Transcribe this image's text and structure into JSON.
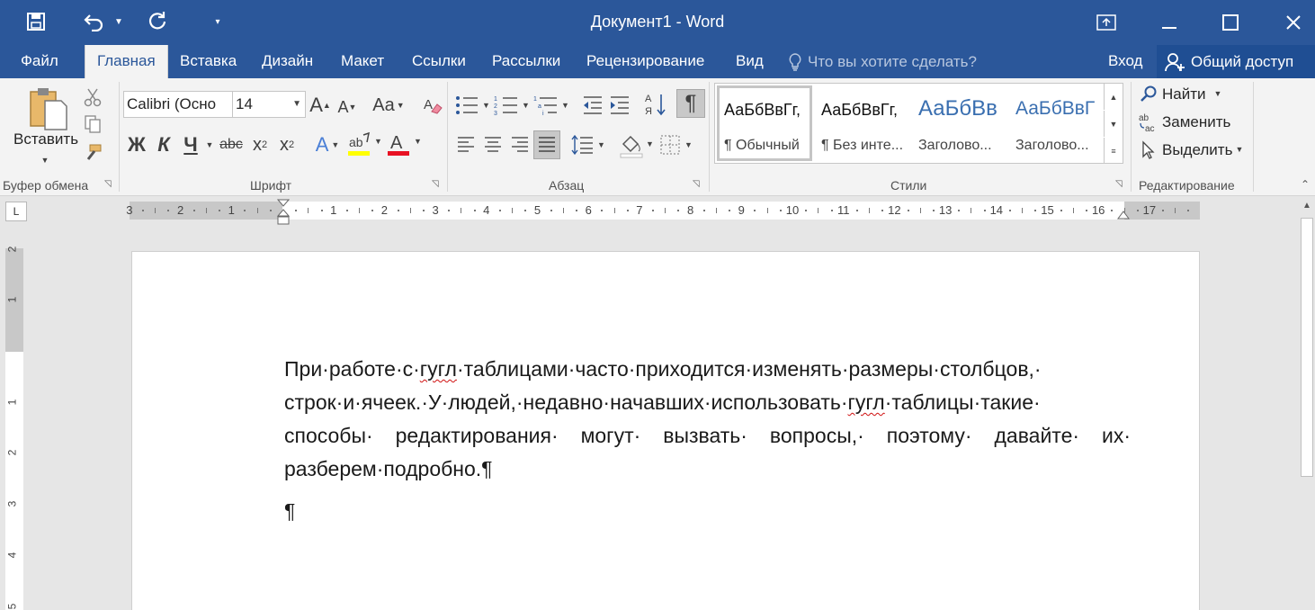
{
  "window": {
    "title": "Документ1 - Word"
  },
  "tabs": [
    {
      "label": "Файл"
    },
    {
      "label": "Главная"
    },
    {
      "label": "Вставка"
    },
    {
      "label": "Дизайн"
    },
    {
      "label": "Макет"
    },
    {
      "label": "Ссылки"
    },
    {
      "label": "Рассылки"
    },
    {
      "label": "Рецензирование"
    },
    {
      "label": "Вид"
    }
  ],
  "tellme_placeholder": "Что вы хотите сделать?",
  "signin_label": "Вход",
  "share_label": "Общий доступ",
  "clipboard": {
    "paste_label": "Вставить",
    "group_label": "Буфер обмена"
  },
  "font": {
    "name": "Calibri (Осно",
    "size": "14",
    "group_label": "Шрифт",
    "bold": "Ж",
    "italic": "К",
    "underline": "Ч",
    "strike": "abc",
    "change_case": "Aa",
    "grow": "A",
    "shrink": "A",
    "font_color": "A",
    "text_effects": "A"
  },
  "paragraph": {
    "group_label": "Абзац",
    "pilcrow": "¶"
  },
  "styles": {
    "group_label": "Стили",
    "items": [
      {
        "sample": "АаБбВвГг,",
        "name": "¶ Обычный"
      },
      {
        "sample": "АаБбВвГг,",
        "name": "¶ Без инте..."
      },
      {
        "sample": "АаБбВв",
        "name": "Заголово..."
      },
      {
        "sample": "АаБбВвГ",
        "name": "Заголово..."
      }
    ]
  },
  "editing": {
    "group_label": "Редактирование",
    "find": "Найти",
    "replace": "Заменить",
    "select": "Выделить"
  },
  "ruler": {
    "numbers": [
      "3",
      "2",
      "1",
      "1",
      "2",
      "3",
      "4",
      "5",
      "6",
      "7",
      "8",
      "9",
      "10",
      "11",
      "12",
      "13",
      "14",
      "15",
      "16",
      "17"
    ],
    "vertical_numbers": [
      "2",
      "1",
      "1",
      "2",
      "3",
      "4",
      "5"
    ],
    "corner": "L"
  },
  "document": {
    "paragraph_parts": [
      "При·работе·с·",
      "гугл",
      "·таблицами·часто·приходится·изменять·размеры·столбцов,· строк·и·ячеек.·У·людей,·недавно·начавших·использовать·",
      "гугл",
      "·таблицы·такие· способы· редактирования· могут· вызвать· вопросы,· поэтому· давайте· их· разберем·подробно.¶"
    ],
    "empty_paragraph": "¶"
  },
  "colors": {
    "title_bar": "#2b579a",
    "highlight": "#ffff00",
    "font_color": "#e81123",
    "spelling": "#d01010"
  }
}
